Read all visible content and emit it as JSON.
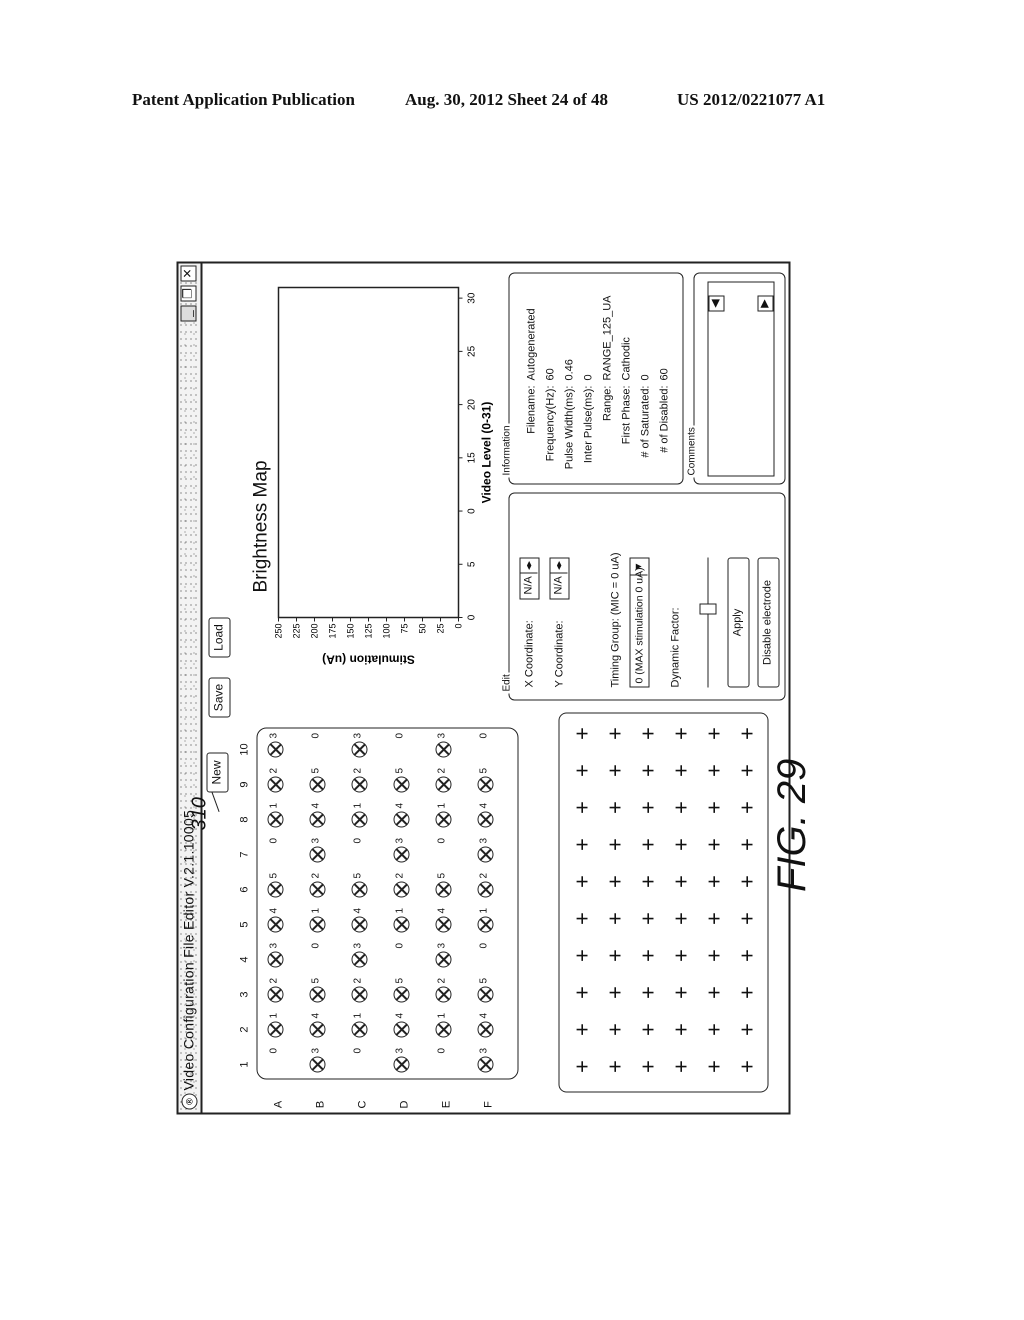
{
  "header": {
    "publication": "Patent Application Publication",
    "date_sheet": "Aug. 30, 2012   Sheet 24 of 48",
    "number": "US 2012/0221077 A1"
  },
  "window": {
    "app_icon": "app-logo-icon",
    "title": "Video Configuration File Editor V.2.1.10005",
    "controls": {
      "minimize": "_",
      "maximize": "❐",
      "close": "✕"
    }
  },
  "toolbar": {
    "reference_numeral": "310",
    "new_label": "New",
    "save_label": "Save",
    "load_label": "Load"
  },
  "electrode_array": {
    "columns": [
      "1",
      "2",
      "3",
      "4",
      "5",
      "6",
      "7",
      "8",
      "9",
      "10"
    ],
    "rows": [
      "A",
      "B",
      "C",
      "D",
      "E",
      "F"
    ],
    "cells": [
      [
        {
          "e": false,
          "v": "0"
        },
        {
          "e": true,
          "v": "1"
        },
        {
          "e": true,
          "v": "2"
        },
        {
          "e": true,
          "v": "3"
        },
        {
          "e": true,
          "v": "4"
        },
        {
          "e": true,
          "v": "5"
        },
        {
          "e": false,
          "v": "0"
        },
        {
          "e": true,
          "v": "1"
        },
        {
          "e": true,
          "v": "2"
        },
        {
          "e": true,
          "v": "3"
        }
      ],
      [
        {
          "e": true,
          "v": "3"
        },
        {
          "e": true,
          "v": "4"
        },
        {
          "e": true,
          "v": "5"
        },
        {
          "e": false,
          "v": "0"
        },
        {
          "e": true,
          "v": "1"
        },
        {
          "e": true,
          "v": "2"
        },
        {
          "e": true,
          "v": "3"
        },
        {
          "e": true,
          "v": "4"
        },
        {
          "e": true,
          "v": "5"
        },
        {
          "e": false,
          "v": "0"
        }
      ],
      [
        {
          "e": false,
          "v": "0"
        },
        {
          "e": true,
          "v": "1"
        },
        {
          "e": true,
          "v": "2"
        },
        {
          "e": true,
          "v": "3"
        },
        {
          "e": true,
          "v": "4"
        },
        {
          "e": true,
          "v": "5"
        },
        {
          "e": false,
          "v": "0"
        },
        {
          "e": true,
          "v": "1"
        },
        {
          "e": true,
          "v": "2"
        },
        {
          "e": true,
          "v": "3"
        }
      ],
      [
        {
          "e": true,
          "v": "3"
        },
        {
          "e": true,
          "v": "4"
        },
        {
          "e": true,
          "v": "5"
        },
        {
          "e": false,
          "v": "0"
        },
        {
          "e": true,
          "v": "1"
        },
        {
          "e": true,
          "v": "2"
        },
        {
          "e": true,
          "v": "3"
        },
        {
          "e": true,
          "v": "4"
        },
        {
          "e": true,
          "v": "5"
        },
        {
          "e": false,
          "v": "0"
        }
      ],
      [
        {
          "e": false,
          "v": "0"
        },
        {
          "e": true,
          "v": "1"
        },
        {
          "e": true,
          "v": "2"
        },
        {
          "e": true,
          "v": "3"
        },
        {
          "e": true,
          "v": "4"
        },
        {
          "e": true,
          "v": "5"
        },
        {
          "e": false,
          "v": "0"
        },
        {
          "e": true,
          "v": "1"
        },
        {
          "e": true,
          "v": "2"
        },
        {
          "e": true,
          "v": "3"
        }
      ],
      [
        {
          "e": true,
          "v": "3"
        },
        {
          "e": true,
          "v": "4"
        },
        {
          "e": true,
          "v": "5"
        },
        {
          "e": false,
          "v": "0"
        },
        {
          "e": true,
          "v": "1"
        },
        {
          "e": true,
          "v": "2"
        },
        {
          "e": true,
          "v": "3"
        },
        {
          "e": true,
          "v": "4"
        },
        {
          "e": true,
          "v": "5"
        },
        {
          "e": false,
          "v": "0"
        }
      ]
    ]
  },
  "chart_data": {
    "type": "line",
    "title": "Brightness Map",
    "xlabel": "Video Level (0-31)",
    "ylabel": "Stimulation (uA)",
    "x_ticks": [
      "0",
      "5",
      "0",
      "15",
      "20",
      "25",
      "30"
    ],
    "y_ticks": [
      "250",
      "225",
      "200",
      "175",
      "150",
      "125",
      "100",
      "75",
      "50",
      "25",
      "0"
    ],
    "xlim": [
      0,
      31
    ],
    "ylim": [
      0,
      250
    ],
    "series": [],
    "grid": false
  },
  "information": {
    "legend": "Information",
    "rows": [
      {
        "key": "Filename:",
        "value": "Autogenerated"
      },
      {
        "key": "Frequency(Hz):",
        "value": "60"
      },
      {
        "key": "Pulse Width(ms):",
        "value": "0.46"
      },
      {
        "key": "Inter Pulse(ms):",
        "value": "0"
      },
      {
        "key": "Range:",
        "value": "RANGE_125_UA"
      },
      {
        "key": "First Phase:",
        "value": "Cathodic"
      },
      {
        "key": "# of Saturated:",
        "value": "0"
      },
      {
        "key": "# of Disabled:",
        "value": "60"
      }
    ]
  },
  "comments": {
    "legend": "Comments",
    "value": "",
    "left_arrow": "◀",
    "right_arrow": "▶"
  },
  "edit": {
    "legend": "Edit",
    "x_label": "X Coordinate:",
    "x_value": "N/A",
    "y_label": "Y Coordinate:",
    "y_value": "N/A",
    "spin_arrows": "◂▸",
    "timing_label": "Timing Group: (MIC = 0 uA)",
    "timing_value": "0 (MAX stimulation 0 uA)",
    "dropdown_arrow": "▼",
    "dynamic_label": "Dynamic Factor:",
    "dynamic_value_fraction": 0.6,
    "apply_label": "Apply",
    "disable_label": "Disable electrode"
  },
  "array2": {
    "rows": 6,
    "cols": 10,
    "glyph": "+"
  },
  "figure_label": "FIG. 29"
}
